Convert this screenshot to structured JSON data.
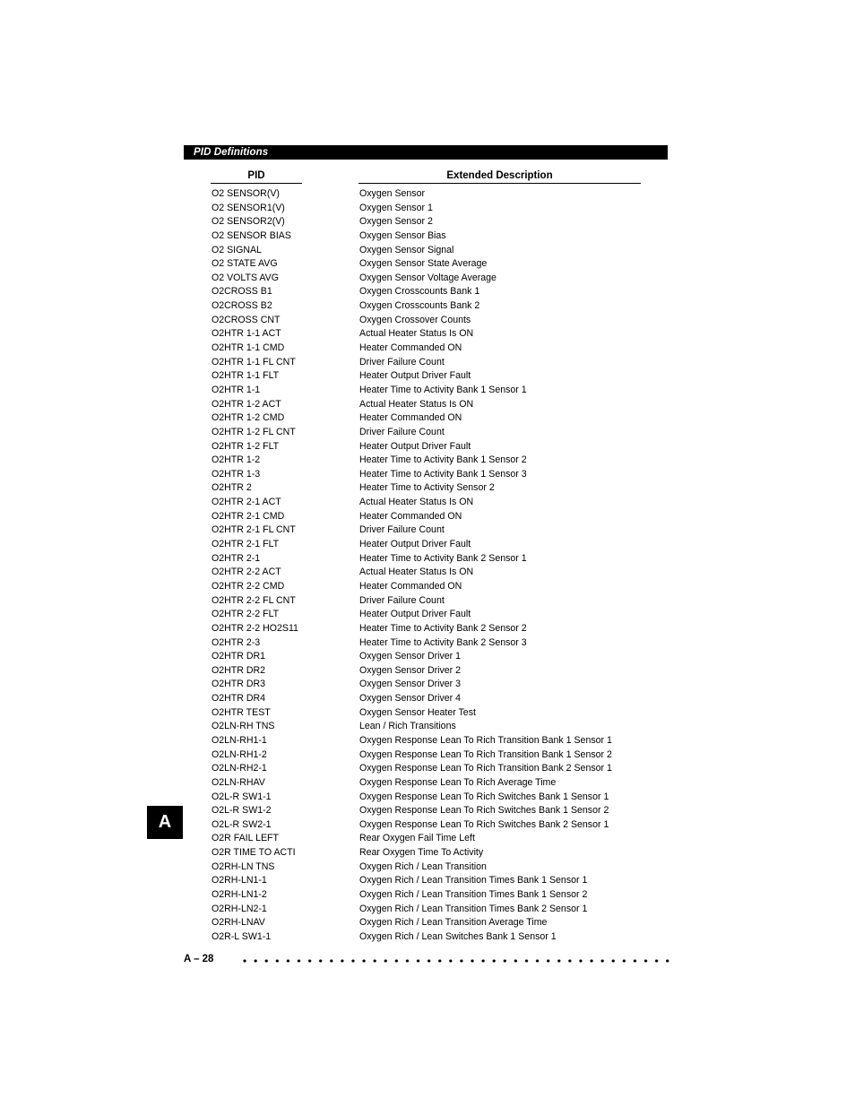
{
  "section": {
    "title": "PID Definitions"
  },
  "table": {
    "headers": {
      "pid": "PID",
      "description": "Extended Description"
    },
    "rows": [
      {
        "pid": "O2 SENSOR(V)",
        "description": "Oxygen Sensor"
      },
      {
        "pid": "O2 SENSOR1(V)",
        "description": "Oxygen Sensor 1"
      },
      {
        "pid": "O2 SENSOR2(V)",
        "description": "Oxygen Sensor 2"
      },
      {
        "pid": "O2 SENSOR BIAS",
        "description": "Oxygen Sensor Bias"
      },
      {
        "pid": "O2 SIGNAL",
        "description": "Oxygen Sensor Signal"
      },
      {
        "pid": "O2 STATE AVG",
        "description": "Oxygen Sensor State Average"
      },
      {
        "pid": "O2 VOLTS AVG",
        "description": "Oxygen Sensor Voltage Average"
      },
      {
        "pid": "O2CROSS B1",
        "description": "Oxygen Crosscounts Bank 1"
      },
      {
        "pid": "O2CROSS B2",
        "description": "Oxygen Crosscounts Bank 2"
      },
      {
        "pid": "O2CROSS CNT",
        "description": "Oxygen Crossover Counts"
      },
      {
        "pid": "O2HTR 1-1 ACT",
        "description": "Actual Heater Status Is ON"
      },
      {
        "pid": "O2HTR 1-1 CMD",
        "description": "Heater Commanded ON"
      },
      {
        "pid": "O2HTR 1-1 FL CNT",
        "description": "Driver Failure Count"
      },
      {
        "pid": "O2HTR 1-1 FLT",
        "description": "Heater Output Driver Fault"
      },
      {
        "pid": "O2HTR 1-1",
        "description": "Heater Time to Activity Bank 1 Sensor 1"
      },
      {
        "pid": "O2HTR 1-2 ACT",
        "description": "Actual Heater Status Is ON"
      },
      {
        "pid": "O2HTR 1-2 CMD",
        "description": "Heater Commanded ON"
      },
      {
        "pid": "O2HTR 1-2 FL CNT",
        "description": "Driver Failure Count"
      },
      {
        "pid": "O2HTR 1-2 FLT",
        "description": "Heater Output Driver Fault"
      },
      {
        "pid": "O2HTR 1-2",
        "description": "Heater Time to Activity Bank 1 Sensor 2"
      },
      {
        "pid": "O2HTR 1-3",
        "description": "Heater Time to Activity Bank 1 Sensor 3"
      },
      {
        "pid": "O2HTR 2",
        "description": "Heater Time to Activity Sensor 2"
      },
      {
        "pid": "O2HTR 2-1 ACT",
        "description": "Actual Heater Status Is ON"
      },
      {
        "pid": "O2HTR 2-1 CMD",
        "description": "Heater Commanded ON"
      },
      {
        "pid": "O2HTR 2-1 FL CNT",
        "description": "Driver Failure Count"
      },
      {
        "pid": "O2HTR 2-1 FLT",
        "description": "Heater Output Driver Fault"
      },
      {
        "pid": "O2HTR 2-1",
        "description": "Heater Time to Activity Bank 2 Sensor 1"
      },
      {
        "pid": "O2HTR 2-2 ACT",
        "description": "Actual Heater Status Is ON"
      },
      {
        "pid": "O2HTR 2-2 CMD",
        "description": "Heater Commanded ON"
      },
      {
        "pid": "O2HTR 2-2 FL CNT",
        "description": "Driver Failure Count"
      },
      {
        "pid": "O2HTR 2-2 FLT",
        "description": "Heater Output Driver Fault"
      },
      {
        "pid": "O2HTR 2-2 HO2S11",
        "description": "Heater Time to Activity Bank 2 Sensor 2"
      },
      {
        "pid": "O2HTR 2-3",
        "description": "Heater Time to Activity Bank 2 Sensor 3"
      },
      {
        "pid": "O2HTR DR1",
        "description": "Oxygen Sensor Driver 1"
      },
      {
        "pid": "O2HTR DR2",
        "description": "Oxygen Sensor Driver 2"
      },
      {
        "pid": "O2HTR DR3",
        "description": "Oxygen Sensor Driver 3"
      },
      {
        "pid": "O2HTR DR4",
        "description": "Oxygen Sensor Driver 4"
      },
      {
        "pid": "O2HTR TEST",
        "description": "Oxygen Sensor Heater Test"
      },
      {
        "pid": "O2LN-RH TNS",
        "description": "Lean / Rich Transitions"
      },
      {
        "pid": "O2LN-RH1-1",
        "description": "Oxygen Response Lean To Rich Transition Bank 1 Sensor 1"
      },
      {
        "pid": "O2LN-RH1-2",
        "description": "Oxygen Response Lean To Rich Transition Bank 1 Sensor 2"
      },
      {
        "pid": "O2LN-RH2-1",
        "description": "Oxygen Response Lean To Rich Transition Bank 2 Sensor 1"
      },
      {
        "pid": "O2LN-RHAV",
        "description": "Oxygen Response Lean To Rich Average Time"
      },
      {
        "pid": "O2L-R SW1-1",
        "description": "Oxygen Response Lean To Rich Switches Bank 1 Sensor 1"
      },
      {
        "pid": "O2L-R SW1-2",
        "description": "Oxygen Response Lean To Rich Switches Bank 1 Sensor 2"
      },
      {
        "pid": "O2L-R SW2-1",
        "description": "Oxygen Response Lean To Rich Switches Bank 2 Sensor 1"
      },
      {
        "pid": "O2R FAIL LEFT",
        "description": "Rear Oxygen Fail Time Left"
      },
      {
        "pid": "O2R TIME TO ACTI",
        "description": "Rear Oxygen Time To Activity"
      },
      {
        "pid": "O2RH-LN TNS",
        "description": "Oxygen Rich / Lean Transition"
      },
      {
        "pid": "O2RH-LN1-1",
        "description": "Oxygen Rich / Lean Transition Times Bank 1 Sensor 1"
      },
      {
        "pid": "O2RH-LN1-2",
        "description": "Oxygen Rich / Lean Transition Times Bank 1 Sensor 2"
      },
      {
        "pid": "O2RH-LN2-1",
        "description": "Oxygen Rich / Lean Transition Times Bank 2 Sensor 1"
      },
      {
        "pid": "O2RH-LNAV",
        "description": "Oxygen Rich / Lean Transition Average Time"
      },
      {
        "pid": "O2R-L SW1-1",
        "description": "Oxygen Rich / Lean Switches Bank 1 Sensor 1"
      }
    ]
  },
  "side_tab": {
    "letter": "A"
  },
  "footer": {
    "page_label": "A – 28"
  },
  "colors": {
    "bar_background": "#000000",
    "bar_text": "#ffffff",
    "page_background": "#ffffff",
    "body_text": "#000000"
  }
}
